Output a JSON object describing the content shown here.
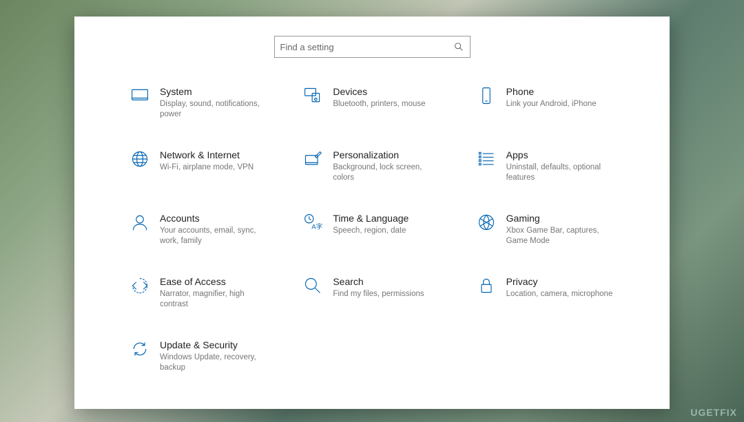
{
  "search": {
    "placeholder": "Find a setting"
  },
  "tiles": {
    "system": {
      "title": "System",
      "desc": "Display, sound, notifications, power"
    },
    "devices": {
      "title": "Devices",
      "desc": "Bluetooth, printers, mouse"
    },
    "phone": {
      "title": "Phone",
      "desc": "Link your Android, iPhone"
    },
    "network": {
      "title": "Network & Internet",
      "desc": "Wi-Fi, airplane mode, VPN"
    },
    "personalization": {
      "title": "Personalization",
      "desc": "Background, lock screen, colors"
    },
    "apps": {
      "title": "Apps",
      "desc": "Uninstall, defaults, optional features"
    },
    "accounts": {
      "title": "Accounts",
      "desc": "Your accounts, email, sync, work, family"
    },
    "time": {
      "title": "Time & Language",
      "desc": "Speech, region, date"
    },
    "gaming": {
      "title": "Gaming",
      "desc": "Xbox Game Bar, captures, Game Mode"
    },
    "ease": {
      "title": "Ease of Access",
      "desc": "Narrator, magnifier, high contrast"
    },
    "searchcat": {
      "title": "Search",
      "desc": "Find my files, permissions"
    },
    "privacy": {
      "title": "Privacy",
      "desc": "Location, camera, microphone"
    },
    "update": {
      "title": "Update & Security",
      "desc": "Windows Update, recovery, backup"
    }
  },
  "watermark": "UGETFIX"
}
